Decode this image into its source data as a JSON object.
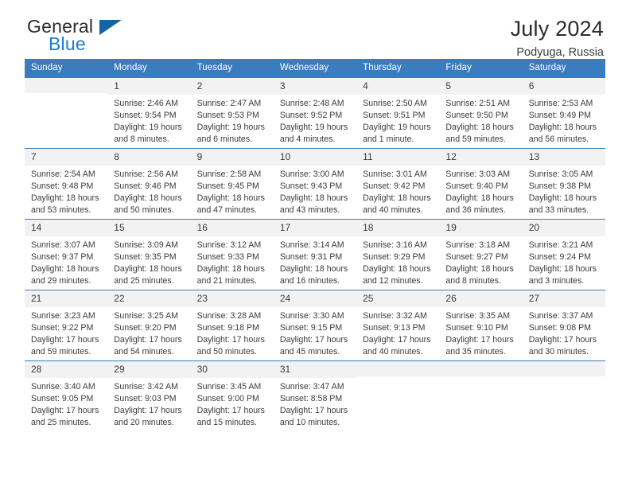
{
  "brand": {
    "name_part1": "General",
    "name_part2": "Blue",
    "accent_color": "#1d7bd4",
    "triangle_color": "#1463a4"
  },
  "header": {
    "title": "July 2024",
    "subtitle": "Podyuga, Russia"
  },
  "calendar": {
    "header_bg": "#3a7cbe",
    "weekday_headers": [
      "Sunday",
      "Monday",
      "Tuesday",
      "Wednesday",
      "Thursday",
      "Friday",
      "Saturday"
    ],
    "weeks": [
      [
        {
          "day": "",
          "sunrise": "",
          "sunset": "",
          "daylight": ""
        },
        {
          "day": "1",
          "sunrise": "Sunrise: 2:46 AM",
          "sunset": "Sunset: 9:54 PM",
          "daylight": "Daylight: 19 hours and 8 minutes."
        },
        {
          "day": "2",
          "sunrise": "Sunrise: 2:47 AM",
          "sunset": "Sunset: 9:53 PM",
          "daylight": "Daylight: 19 hours and 6 minutes."
        },
        {
          "day": "3",
          "sunrise": "Sunrise: 2:48 AM",
          "sunset": "Sunset: 9:52 PM",
          "daylight": "Daylight: 19 hours and 4 minutes."
        },
        {
          "day": "4",
          "sunrise": "Sunrise: 2:50 AM",
          "sunset": "Sunset: 9:51 PM",
          "daylight": "Daylight: 19 hours and 1 minute."
        },
        {
          "day": "5",
          "sunrise": "Sunrise: 2:51 AM",
          "sunset": "Sunset: 9:50 PM",
          "daylight": "Daylight: 18 hours and 59 minutes."
        },
        {
          "day": "6",
          "sunrise": "Sunrise: 2:53 AM",
          "sunset": "Sunset: 9:49 PM",
          "daylight": "Daylight: 18 hours and 56 minutes."
        }
      ],
      [
        {
          "day": "7",
          "sunrise": "Sunrise: 2:54 AM",
          "sunset": "Sunset: 9:48 PM",
          "daylight": "Daylight: 18 hours and 53 minutes."
        },
        {
          "day": "8",
          "sunrise": "Sunrise: 2:56 AM",
          "sunset": "Sunset: 9:46 PM",
          "daylight": "Daylight: 18 hours and 50 minutes."
        },
        {
          "day": "9",
          "sunrise": "Sunrise: 2:58 AM",
          "sunset": "Sunset: 9:45 PM",
          "daylight": "Daylight: 18 hours and 47 minutes."
        },
        {
          "day": "10",
          "sunrise": "Sunrise: 3:00 AM",
          "sunset": "Sunset: 9:43 PM",
          "daylight": "Daylight: 18 hours and 43 minutes."
        },
        {
          "day": "11",
          "sunrise": "Sunrise: 3:01 AM",
          "sunset": "Sunset: 9:42 PM",
          "daylight": "Daylight: 18 hours and 40 minutes."
        },
        {
          "day": "12",
          "sunrise": "Sunrise: 3:03 AM",
          "sunset": "Sunset: 9:40 PM",
          "daylight": "Daylight: 18 hours and 36 minutes."
        },
        {
          "day": "13",
          "sunrise": "Sunrise: 3:05 AM",
          "sunset": "Sunset: 9:38 PM",
          "daylight": "Daylight: 18 hours and 33 minutes."
        }
      ],
      [
        {
          "day": "14",
          "sunrise": "Sunrise: 3:07 AM",
          "sunset": "Sunset: 9:37 PM",
          "daylight": "Daylight: 18 hours and 29 minutes."
        },
        {
          "day": "15",
          "sunrise": "Sunrise: 3:09 AM",
          "sunset": "Sunset: 9:35 PM",
          "daylight": "Daylight: 18 hours and 25 minutes."
        },
        {
          "day": "16",
          "sunrise": "Sunrise: 3:12 AM",
          "sunset": "Sunset: 9:33 PM",
          "daylight": "Daylight: 18 hours and 21 minutes."
        },
        {
          "day": "17",
          "sunrise": "Sunrise: 3:14 AM",
          "sunset": "Sunset: 9:31 PM",
          "daylight": "Daylight: 18 hours and 16 minutes."
        },
        {
          "day": "18",
          "sunrise": "Sunrise: 3:16 AM",
          "sunset": "Sunset: 9:29 PM",
          "daylight": "Daylight: 18 hours and 12 minutes."
        },
        {
          "day": "19",
          "sunrise": "Sunrise: 3:18 AM",
          "sunset": "Sunset: 9:27 PM",
          "daylight": "Daylight: 18 hours and 8 minutes."
        },
        {
          "day": "20",
          "sunrise": "Sunrise: 3:21 AM",
          "sunset": "Sunset: 9:24 PM",
          "daylight": "Daylight: 18 hours and 3 minutes."
        }
      ],
      [
        {
          "day": "21",
          "sunrise": "Sunrise: 3:23 AM",
          "sunset": "Sunset: 9:22 PM",
          "daylight": "Daylight: 17 hours and 59 minutes."
        },
        {
          "day": "22",
          "sunrise": "Sunrise: 3:25 AM",
          "sunset": "Sunset: 9:20 PM",
          "daylight": "Daylight: 17 hours and 54 minutes."
        },
        {
          "day": "23",
          "sunrise": "Sunrise: 3:28 AM",
          "sunset": "Sunset: 9:18 PM",
          "daylight": "Daylight: 17 hours and 50 minutes."
        },
        {
          "day": "24",
          "sunrise": "Sunrise: 3:30 AM",
          "sunset": "Sunset: 9:15 PM",
          "daylight": "Daylight: 17 hours and 45 minutes."
        },
        {
          "day": "25",
          "sunrise": "Sunrise: 3:32 AM",
          "sunset": "Sunset: 9:13 PM",
          "daylight": "Daylight: 17 hours and 40 minutes."
        },
        {
          "day": "26",
          "sunrise": "Sunrise: 3:35 AM",
          "sunset": "Sunset: 9:10 PM",
          "daylight": "Daylight: 17 hours and 35 minutes."
        },
        {
          "day": "27",
          "sunrise": "Sunrise: 3:37 AM",
          "sunset": "Sunset: 9:08 PM",
          "daylight": "Daylight: 17 hours and 30 minutes."
        }
      ],
      [
        {
          "day": "28",
          "sunrise": "Sunrise: 3:40 AM",
          "sunset": "Sunset: 9:05 PM",
          "daylight": "Daylight: 17 hours and 25 minutes."
        },
        {
          "day": "29",
          "sunrise": "Sunrise: 3:42 AM",
          "sunset": "Sunset: 9:03 PM",
          "daylight": "Daylight: 17 hours and 20 minutes."
        },
        {
          "day": "30",
          "sunrise": "Sunrise: 3:45 AM",
          "sunset": "Sunset: 9:00 PM",
          "daylight": "Daylight: 17 hours and 15 minutes."
        },
        {
          "day": "31",
          "sunrise": "Sunrise: 3:47 AM",
          "sunset": "Sunset: 8:58 PM",
          "daylight": "Daylight: 17 hours and 10 minutes."
        },
        {
          "day": "",
          "sunrise": "",
          "sunset": "",
          "daylight": ""
        },
        {
          "day": "",
          "sunrise": "",
          "sunset": "",
          "daylight": ""
        },
        {
          "day": "",
          "sunrise": "",
          "sunset": "",
          "daylight": ""
        }
      ]
    ]
  }
}
